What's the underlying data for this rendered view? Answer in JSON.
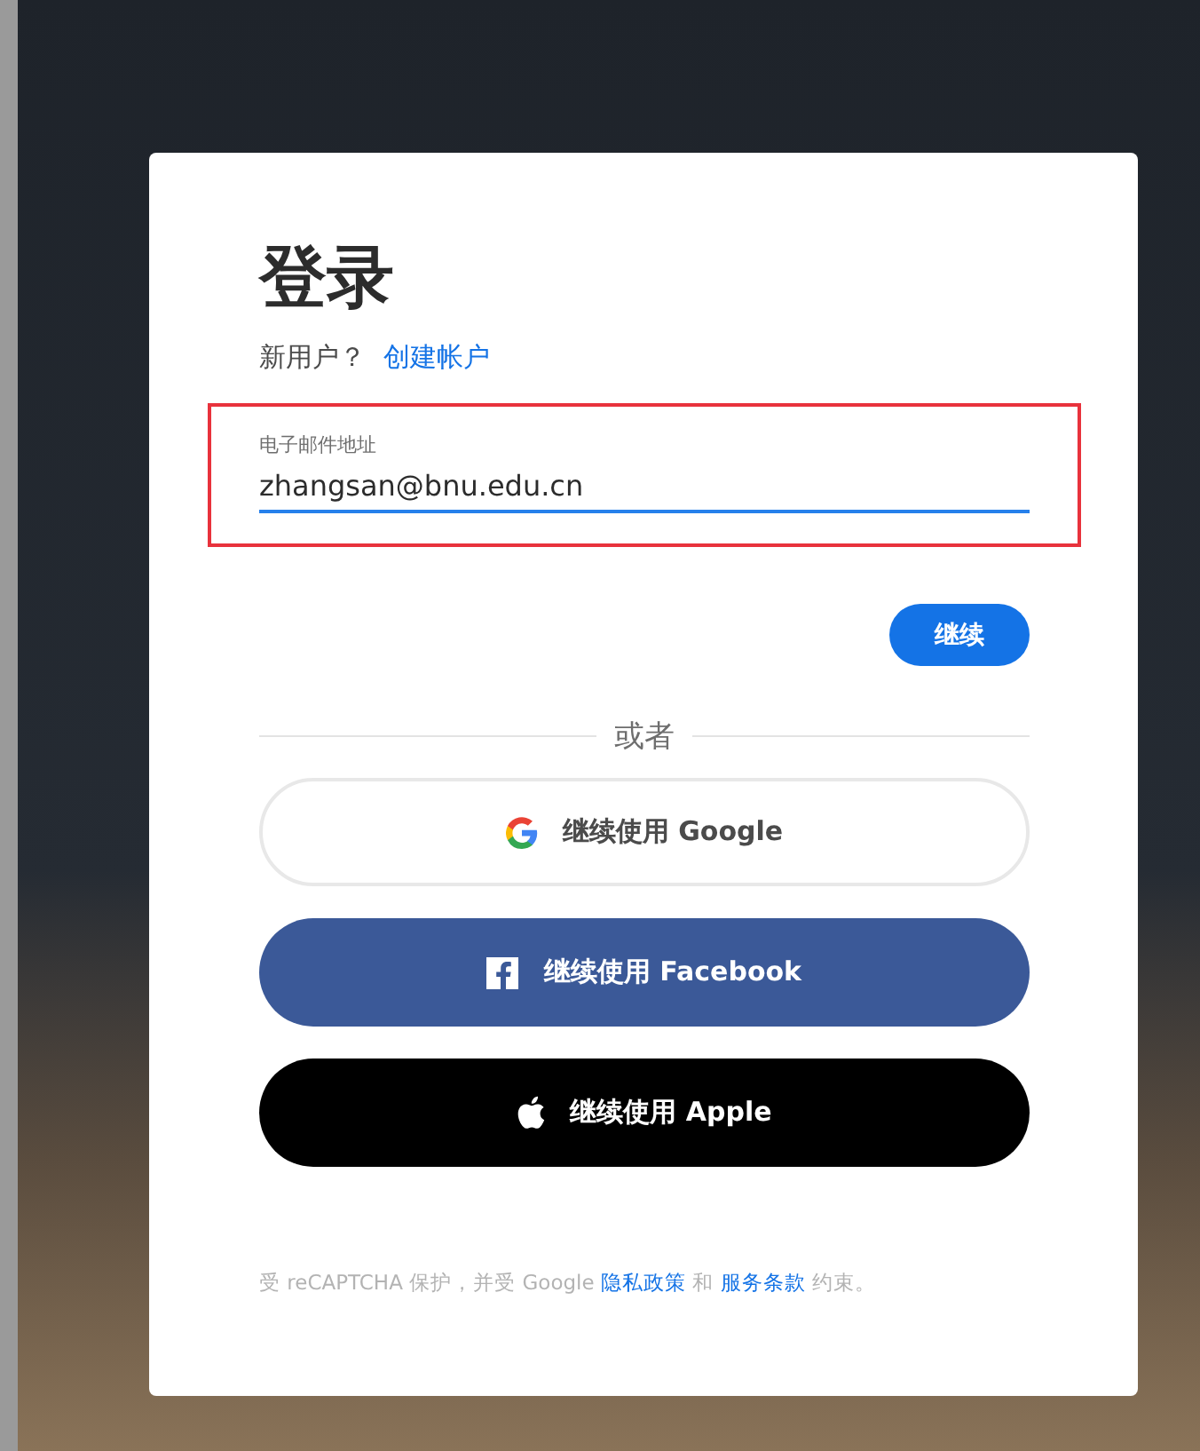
{
  "title": "登录",
  "signup": {
    "prompt": "新用户？",
    "link": "创建帐户"
  },
  "email_field": {
    "label": "电子邮件地址",
    "value": "zhangsan@bnu.edu.cn",
    "highlighted": true
  },
  "continue_button": "继续",
  "divider_text": "或者",
  "social_buttons": [
    {
      "kind": "google",
      "label": "继续使用 Google"
    },
    {
      "kind": "facebook",
      "label": "继续使用 Facebook"
    },
    {
      "kind": "apple",
      "label": "继续使用 Apple"
    }
  ],
  "footer": [
    {
      "kind": "text",
      "text": "受 reCAPTCHA 保护，并受 Google "
    },
    {
      "kind": "link",
      "text": "隐私政策"
    },
    {
      "kind": "text",
      "text": " 和 "
    },
    {
      "kind": "link",
      "text": "服务条款"
    },
    {
      "kind": "text",
      "text": " 约束。"
    }
  ]
}
